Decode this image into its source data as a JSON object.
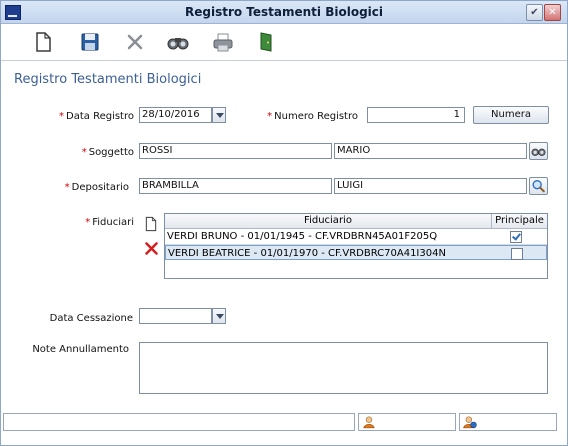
{
  "window": {
    "title": "Registro Testamenti Biologici"
  },
  "toolbar": {
    "icons": [
      "new-document-icon",
      "save-icon",
      "delete-icon",
      "binoculars-icon",
      "print-icon",
      "exit-icon"
    ]
  },
  "form": {
    "heading": "Registro Testamenti Biologici",
    "required_mark": "*",
    "data_registro": {
      "label": "Data Registro",
      "value": "28/10/2016"
    },
    "numero_registro": {
      "label": "Numero Registro",
      "value": "1",
      "button": "Numera"
    },
    "soggetto": {
      "label": "Soggetto",
      "cognome": "ROSSI",
      "nome": "MARIO"
    },
    "depositario": {
      "label": "Depositario",
      "cognome": "BRAMBILLA",
      "nome": "LUIGI"
    },
    "fiduciari": {
      "label": "Fiduciari",
      "columns": [
        "Fiduciario",
        "Principale"
      ],
      "rows": [
        {
          "name": "VERDI BRUNO - 01/01/1945 - CF.VRDBRN45A01F205Q",
          "principale": true
        },
        {
          "name": "VERDI BEATRICE - 01/01/1970 - CF.VRDBRC70A41I304N",
          "principale": false
        }
      ]
    },
    "data_cessazione": {
      "label": "Data Cessazione",
      "value": ""
    },
    "note_annullamento": {
      "label": "Note Annullamento",
      "value": ""
    }
  },
  "colors": {
    "heading": "#3c5f96",
    "required": "#d30000",
    "selection": "#dde8f5"
  }
}
